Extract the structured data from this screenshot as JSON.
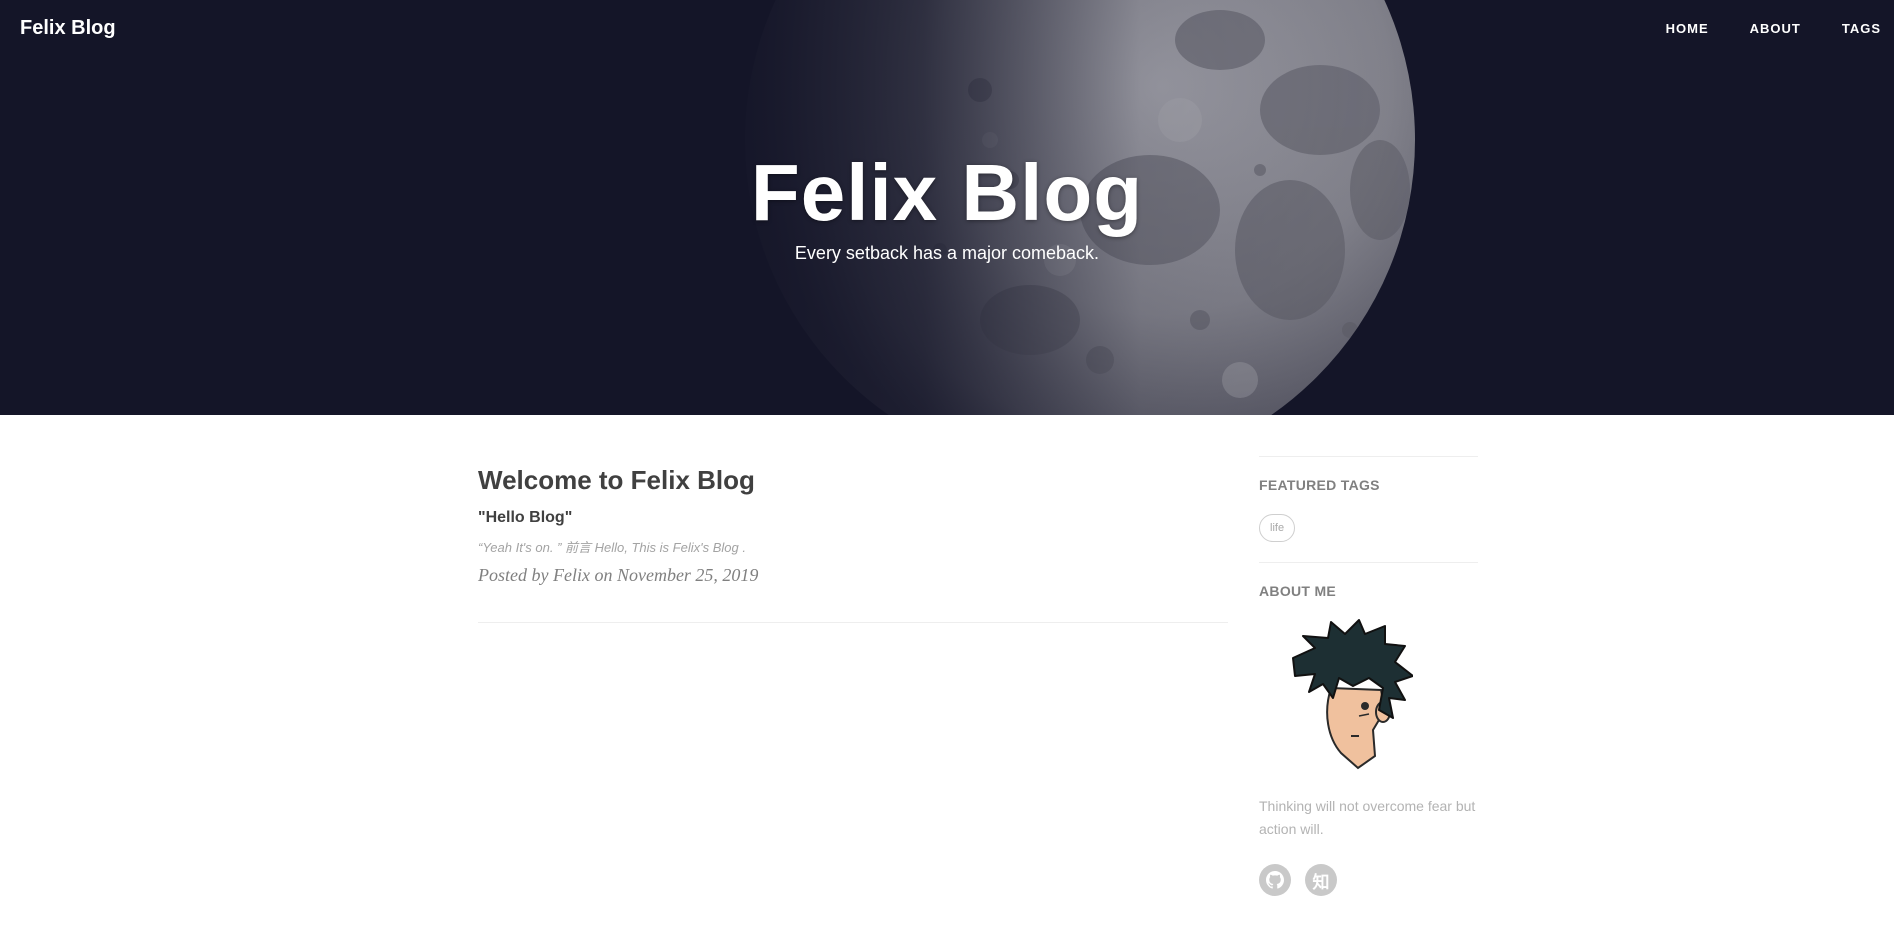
{
  "nav": {
    "brand": "Felix Blog",
    "links": [
      {
        "label": "HOME"
      },
      {
        "label": "ABOUT"
      },
      {
        "label": "TAGS"
      }
    ]
  },
  "hero": {
    "title": "Felix Blog",
    "subtitle": "Every setback has a major comeback."
  },
  "posts": [
    {
      "title": "Welcome to Felix Blog",
      "subtitle": "\"Hello Blog\"",
      "excerpt": "“Yeah It's on. ” 前言 Hello, This is Felix's Blog .",
      "meta": "Posted by Felix on November 25, 2019"
    }
  ],
  "sidebar": {
    "featured_tags_heading": "FEATURED TAGS",
    "tags": [
      {
        "label": "life"
      }
    ],
    "about_heading": "ABOUT ME",
    "about_text": "Thinking will not overcome fear but action will.",
    "social": [
      {
        "icon": "github-icon"
      },
      {
        "icon": "zhihu-icon",
        "glyph": "知"
      }
    ]
  },
  "colors": {
    "hero_background": "#141528",
    "moon": "#8e8e96",
    "text": "#404040",
    "muted": "#a3a3a3"
  }
}
